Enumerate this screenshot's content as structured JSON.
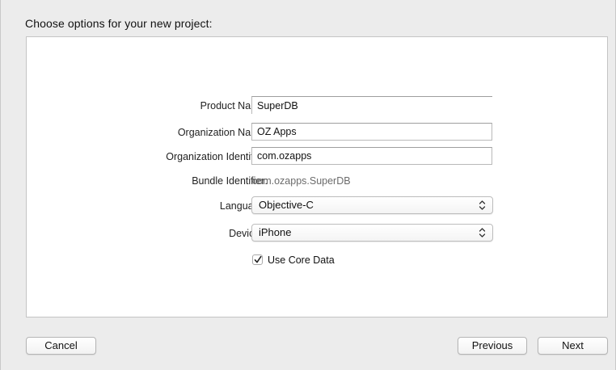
{
  "dialog": {
    "heading": "Choose options for your new project:"
  },
  "form": {
    "product_name": {
      "label": "Product Name:",
      "value": "SuperDB"
    },
    "organization_name": {
      "label": "Organization Name:",
      "value": "OZ Apps"
    },
    "organization_identifier": {
      "label": "Organization Identifier:",
      "value": "com.ozapps"
    },
    "bundle_identifier": {
      "label": "Bundle Identifier:",
      "value": "com.ozapps.SuperDB"
    },
    "language": {
      "label": "Language:",
      "selected": "Objective-C"
    },
    "devices": {
      "label": "Devices:",
      "selected": "iPhone"
    },
    "use_core_data": {
      "label": "Use Core Data",
      "checked": true
    }
  },
  "buttons": {
    "cancel": "Cancel",
    "previous": "Previous",
    "next": "Next"
  },
  "icons": {
    "popup_arrows": "up-down-chevrons-icon",
    "checkmark": "checkmark-icon"
  }
}
